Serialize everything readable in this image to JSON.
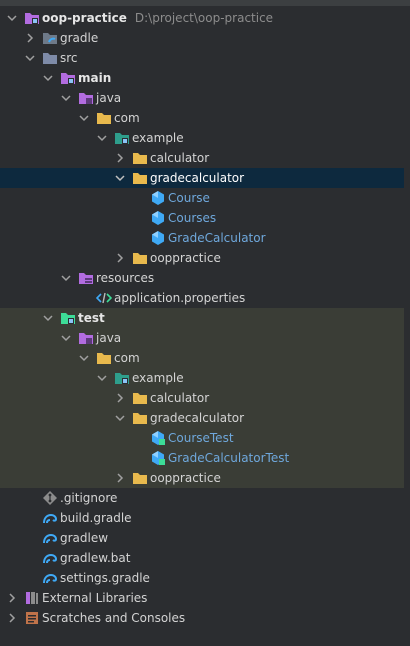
{
  "project": {
    "name": "oop-practice",
    "path": "D:\\project\\oop-practice"
  },
  "nodes": {
    "gradle": "gradle",
    "src": "src",
    "main": "main",
    "main_java": "java",
    "main_com": "com",
    "main_example": "example",
    "main_calculator": "calculator",
    "main_gradecalculator": "gradecalculator",
    "course": "Course",
    "courses": "Courses",
    "gradecalculator_class": "GradeCalculator",
    "main_ooppractice": "ooppractice",
    "resources": "resources",
    "application_properties": "application.properties",
    "test": "test",
    "test_java": "java",
    "test_com": "com",
    "test_example": "example",
    "test_calculator": "calculator",
    "test_gradecalculator": "gradecalculator",
    "coursetest": "CourseTest",
    "gradecalculatortest": "GradeCalculatorTest",
    "test_ooppractice": "ooppractice",
    "gitignore": ".gitignore",
    "build_gradle": "build.gradle",
    "gradlew": "gradlew",
    "gradlew_bat": "gradlew.bat",
    "settings_gradle": "settings.gradle",
    "external_libraries": "External Libraries",
    "scratches": "Scratches and Consoles"
  },
  "colors": {
    "background": "#2b2d30",
    "selected_row": "#0d293e",
    "test_scope_bg": "#3a3d36",
    "folder": "#e8b94d",
    "module_folder": "#b26ce0",
    "test_folder": "#3ddc97",
    "class_icon": "#3fa9f5",
    "class_text": "#6fa8dc"
  }
}
